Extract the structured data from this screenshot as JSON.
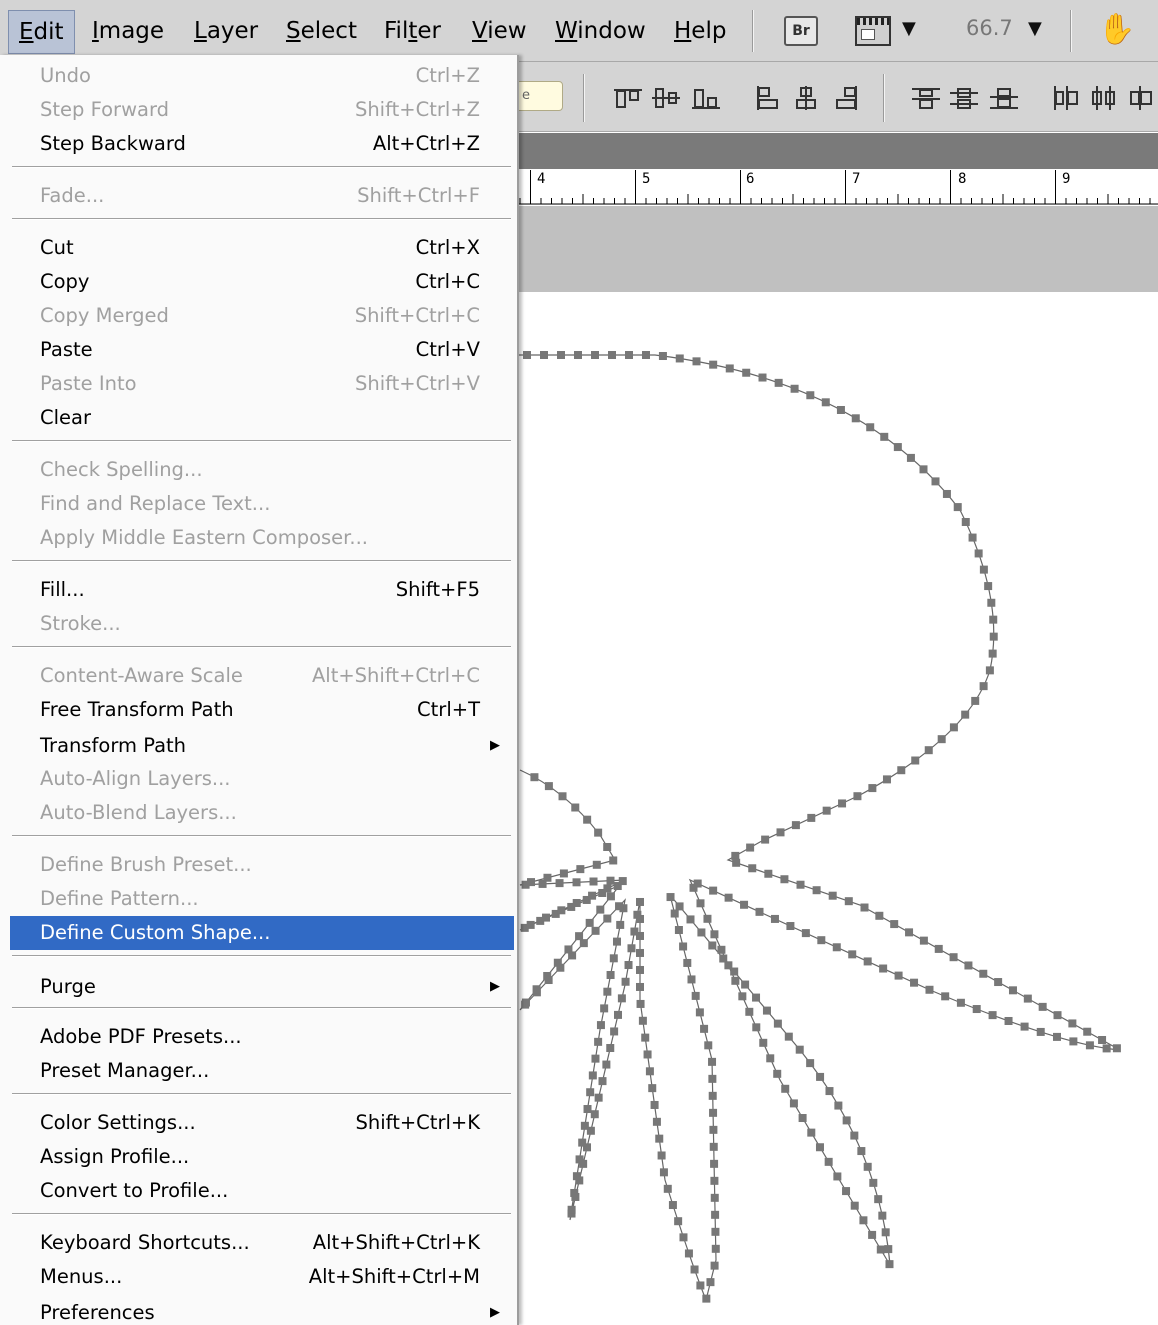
{
  "menubar": {
    "items": [
      {
        "label": "Edit",
        "accel": "E",
        "rest": "dit",
        "active": true
      },
      {
        "label": "Image",
        "accel": "I",
        "rest": "mage"
      },
      {
        "label": "Layer",
        "accel": "L",
        "rest": "ayer"
      },
      {
        "label": "Select",
        "accel": "S",
        "rest": "elect"
      },
      {
        "label": "Filter",
        "pre": "Fil",
        "accel": "t",
        "rest": "er"
      },
      {
        "label": "View",
        "accel": "V",
        "rest": "iew"
      },
      {
        "label": "Window",
        "accel": "W",
        "rest": "indow"
      },
      {
        "label": "Help",
        "accel": "H",
        "rest": "elp"
      }
    ],
    "bridge_label": "Br",
    "zoom": "66.7",
    "icons": [
      "bridge-icon",
      "screen-mode-icon",
      "hand-tool-icon"
    ]
  },
  "optionsbar": {
    "field_text": "e"
  },
  "ruler": {
    "ticks": [
      "4",
      "5",
      "6",
      "7",
      "8",
      "9"
    ]
  },
  "edit_menu": {
    "items": [
      {
        "label": "Undo",
        "shortcut": "Ctrl+Z",
        "enabled": false
      },
      {
        "label": "Step Forward",
        "shortcut": "Shift+Ctrl+Z",
        "enabled": false
      },
      {
        "label": "Step Backward",
        "shortcut": "Alt+Ctrl+Z",
        "enabled": true
      },
      {
        "label": "Fade...",
        "shortcut": "Shift+Ctrl+F",
        "enabled": false
      },
      {
        "label": "Cut",
        "shortcut": "Ctrl+X",
        "enabled": true
      },
      {
        "label": "Copy",
        "shortcut": "Ctrl+C",
        "enabled": true
      },
      {
        "label": "Copy Merged",
        "shortcut": "Shift+Ctrl+C",
        "enabled": false
      },
      {
        "label": "Paste",
        "shortcut": "Ctrl+V",
        "enabled": true
      },
      {
        "label": "Paste Into",
        "shortcut": "Shift+Ctrl+V",
        "enabled": false
      },
      {
        "label": "Clear",
        "shortcut": "",
        "enabled": true
      },
      {
        "label": "Check Spelling...",
        "shortcut": "",
        "enabled": false
      },
      {
        "label": "Find and Replace Text...",
        "shortcut": "",
        "enabled": false
      },
      {
        "label": "Apply Middle Eastern Composer...",
        "shortcut": "",
        "enabled": false
      },
      {
        "label": "Fill...",
        "shortcut": "Shift+F5",
        "enabled": true
      },
      {
        "label": "Stroke...",
        "shortcut": "",
        "enabled": false
      },
      {
        "label": "Content-Aware Scale",
        "shortcut": "Alt+Shift+Ctrl+C",
        "enabled": false
      },
      {
        "label": "Free Transform Path",
        "shortcut": "Ctrl+T",
        "enabled": true
      },
      {
        "label": "Transform Path",
        "shortcut": "",
        "enabled": true,
        "submenu": true
      },
      {
        "label": "Auto-Align Layers...",
        "shortcut": "",
        "enabled": false
      },
      {
        "label": "Auto-Blend Layers...",
        "shortcut": "",
        "enabled": false
      },
      {
        "label": "Define Brush Preset...",
        "shortcut": "",
        "enabled": false
      },
      {
        "label": "Define Pattern...",
        "shortcut": "",
        "enabled": false
      },
      {
        "label": "Define Custom Shape...",
        "shortcut": "",
        "enabled": true,
        "highlighted": true
      },
      {
        "label": "Purge",
        "shortcut": "",
        "enabled": true,
        "submenu": true
      },
      {
        "label": "Adobe PDF Presets...",
        "shortcut": "",
        "enabled": true
      },
      {
        "label": "Preset Manager...",
        "shortcut": "",
        "enabled": true
      },
      {
        "label": "Color Settings...",
        "shortcut": "Shift+Ctrl+K",
        "enabled": true
      },
      {
        "label": "Assign Profile...",
        "shortcut": "",
        "enabled": true
      },
      {
        "label": "Convert to Profile...",
        "shortcut": "",
        "enabled": true
      },
      {
        "label": "Keyboard Shortcuts...",
        "shortcut": "Alt+Shift+Ctrl+K",
        "enabled": true
      },
      {
        "label": "Menus...",
        "shortcut": "Alt+Shift+Ctrl+M",
        "enabled": true
      },
      {
        "label": "Preferences",
        "shortcut": "",
        "enabled": true,
        "submenu": true
      }
    ]
  },
  "colors": {
    "highlight": "#316ac5",
    "disabled_text": "#a0a0a0",
    "path_anchor": "#777777",
    "path_stroke": "#666666"
  }
}
